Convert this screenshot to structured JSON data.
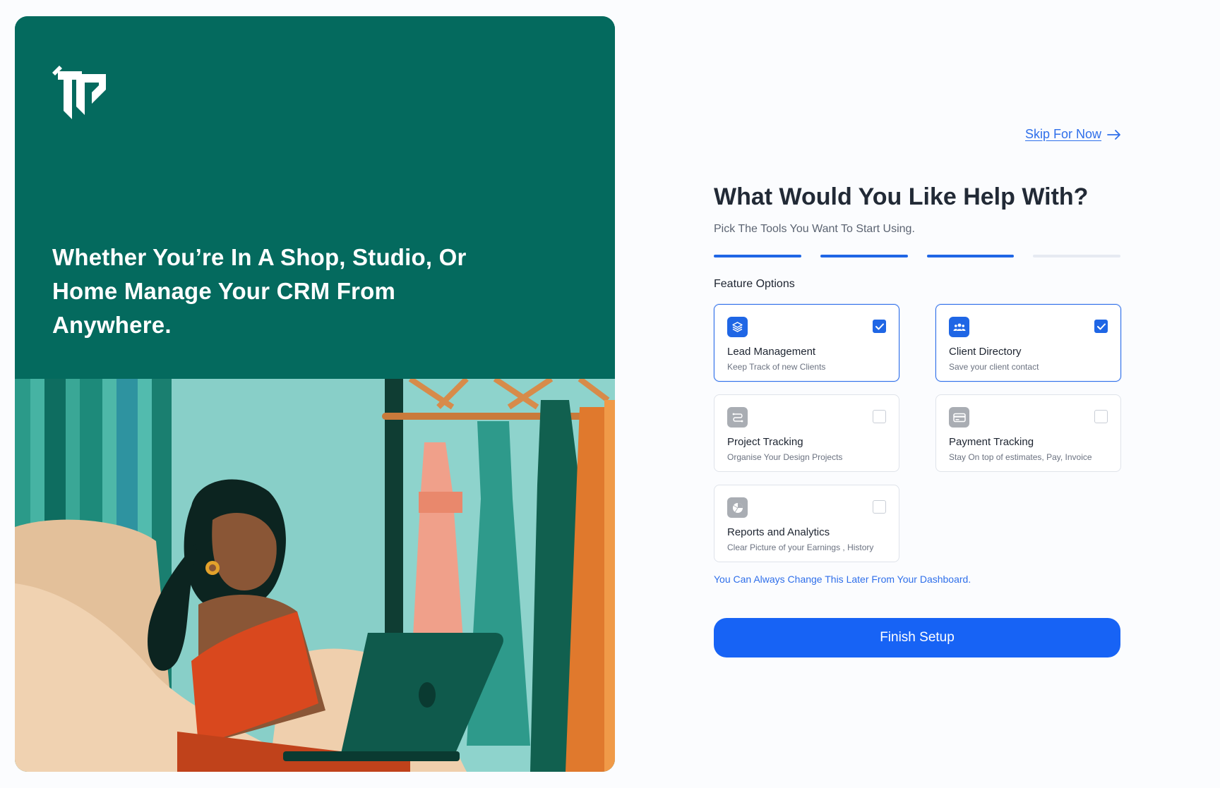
{
  "hero": {
    "tagline": "Whether You’re In A Shop, Studio, Or Home Manage Your CRM From Anywhere.",
    "logo_icon": "brand-logo-icon",
    "illustration": "woman-with-laptop-and-clothing-rack-illustration",
    "background_color": "#046a5e"
  },
  "header": {
    "skip_label": "Skip For Now",
    "skip_icon": "arrow-right-icon"
  },
  "main": {
    "title": "What Would You Like Help With?",
    "subtitle": "Pick The Tools You Want To Start Using.",
    "progress": {
      "total_steps": 4,
      "completed_steps": 3
    },
    "section_label": "Feature Options",
    "features": [
      {
        "title": "Lead Management",
        "description": "Keep Track of new Clients",
        "icon": "layers-icon",
        "checked": true
      },
      {
        "title": "Client Directory",
        "description": "Save your client contact",
        "icon": "users-icon",
        "checked": true
      },
      {
        "title": "Project Tracking",
        "description": "Organise Your Design Projects",
        "icon": "route-icon",
        "checked": false
      },
      {
        "title": "Payment Tracking",
        "description": "Stay On top of estimates, Pay, Invoice",
        "icon": "credit-card-icon",
        "checked": false
      },
      {
        "title": "Reports and Analytics",
        "description": "Clear Picture of your Earnings , History",
        "icon": "pie-chart-icon",
        "checked": false
      }
    ],
    "note": "You Can Always Change This Later From Your Dashboard.",
    "finish_label": "Finish Setup"
  },
  "colors": {
    "accent": "#1f66e5",
    "link": "#2f6fea",
    "hero_green": "#046a5e"
  }
}
